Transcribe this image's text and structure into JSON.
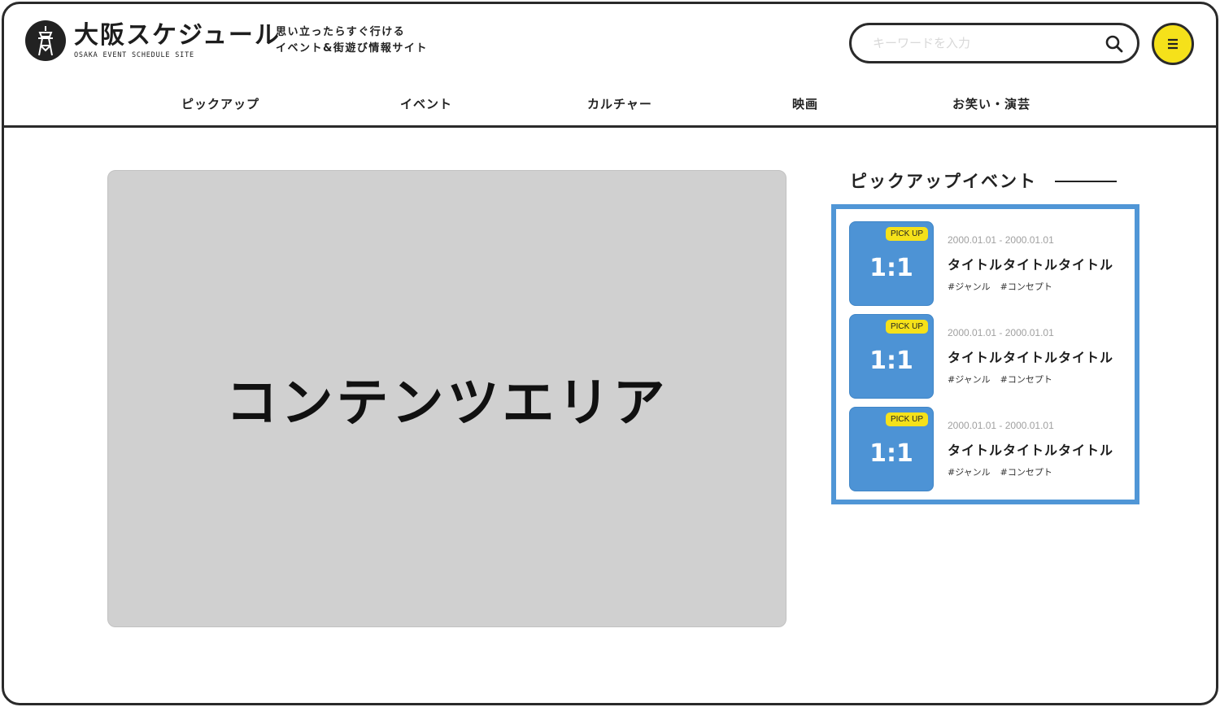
{
  "header": {
    "logo_title": "大阪スケジュール",
    "logo_subtitle": "OSAKA EVENT SCHEDULE SITE",
    "tagline_line1": "思い立ったらすぐ行ける",
    "tagline_line2": "イベント&街遊び情報サイト",
    "search_placeholder": "キーワードを入力",
    "icons": {
      "logo": "tower-icon",
      "search": "search-icon",
      "menu": "hamburger-menu-icon"
    },
    "colors": {
      "accent_yellow": "#f5e11a",
      "border": "#2a2a2a"
    }
  },
  "nav": {
    "items": [
      "ピックアップ",
      "イベント",
      "カルチャー",
      "映画",
      "お笑い・演芸"
    ]
  },
  "main": {
    "content_label": "コンテンツエリア",
    "content_bg": "#d0d0d0"
  },
  "sidebar": {
    "heading": "ピックアップイベント",
    "box_color": "#5096d6",
    "cards": [
      {
        "badge": "PICK UP",
        "ratio": "1:1",
        "date": "2000.01.01 - 2000.01.01",
        "title": "タイトルタイトルタイトル",
        "tag1": "#ジャンル",
        "tag2": "#コンセプト"
      },
      {
        "badge": "PICK UP",
        "ratio": "1:1",
        "date": "2000.01.01 - 2000.01.01",
        "title": "タイトルタイトルタイトル",
        "tag1": "#ジャンル",
        "tag2": "#コンセプト"
      },
      {
        "badge": "PICK UP",
        "ratio": "1:1",
        "date": "2000.01.01 - 2000.01.01",
        "title": "タイトルタイトルタイトル",
        "tag1": "#ジャンル",
        "tag2": "#コンセプト"
      }
    ]
  }
}
